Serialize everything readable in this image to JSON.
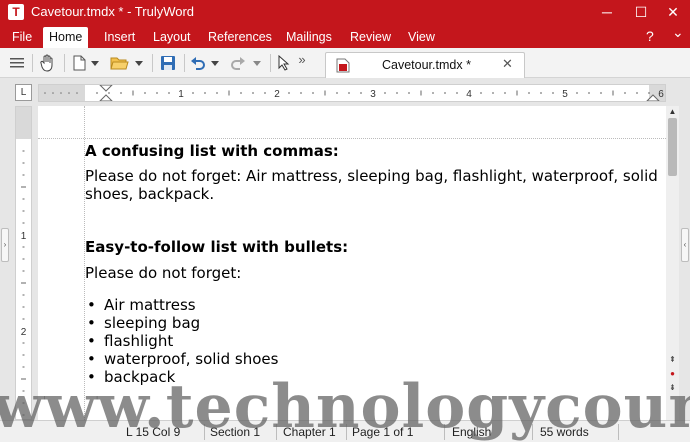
{
  "window": {
    "title": "Cavetour.tmdx * - TrulyWord",
    "app_icon_letter": "T",
    "minimize_icon": "─",
    "maximize_icon": "☐",
    "close_icon": "✕"
  },
  "menu": {
    "items": [
      "File",
      "Home",
      "Insert",
      "Layout",
      "References",
      "Mailings",
      "Review",
      "View"
    ],
    "active": "Home",
    "help_icon": "?",
    "collapse_icon": "⌄"
  },
  "toolbar": {
    "more_icon": "»",
    "document_tab": {
      "label": "Cavetour.tmdx *",
      "close_icon": "✕"
    }
  },
  "ruler": {
    "corner_symbol": "L",
    "h_numbers": [
      "1",
      "2",
      "3",
      "4",
      "5",
      "6"
    ],
    "v_numbers": [
      "1",
      "2"
    ]
  },
  "document": {
    "heading1": "A confusing list with commas:",
    "para1_line1": "Please do not forget: Air mattress, sleeping bag, flashlight, waterproof, solid",
    "para1_line2": "shoes, backpack.",
    "heading2": "Easy-to-follow list with bullets:",
    "para2": "Please do not forget:",
    "bullet_symbol": "•",
    "bullet_items": [
      "Air mattress",
      "sleeping bag",
      "flashlight",
      "waterproof, solid shoes",
      "backpack"
    ]
  },
  "statusbar": {
    "line_col": "L 15 Col 9",
    "section": "Section 1",
    "chapter": "Chapter 1",
    "page": "Page 1 of 1",
    "language": "English",
    "words": "55 words"
  },
  "watermark": {
    "text": "www.technologycounter.com"
  },
  "colors": {
    "brand_red": "#c4161c",
    "toolbar_bg": "#f3f3f3",
    "workspace_bg": "#e6e6e6"
  }
}
